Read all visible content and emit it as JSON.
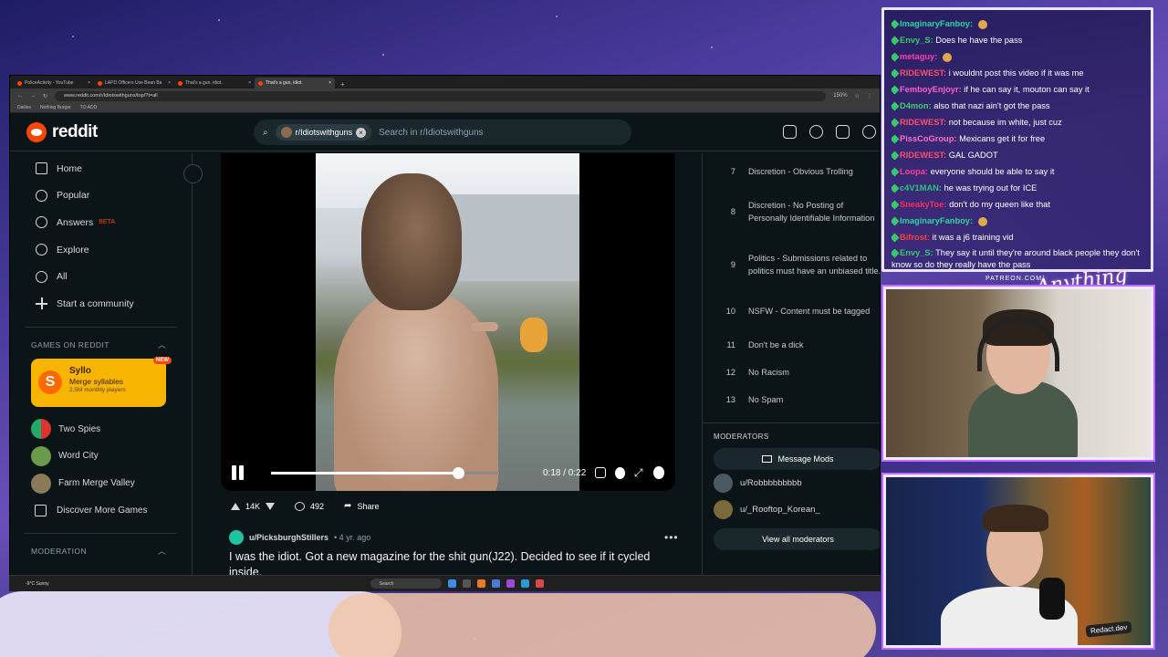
{
  "browser": {
    "tabs": [
      {
        "label": "PoliceActivity - YouTube",
        "active": false
      },
      {
        "label": "LAPD Officers Use Bean Ba",
        "active": false
      },
      {
        "label": "That's a gun, idiot.",
        "active": false
      },
      {
        "label": "That's a gun, idiot.",
        "active": true
      }
    ],
    "url": "www.reddit.com/r/Idiotswithguns/top/?t=all",
    "zoom": "150%",
    "bookmarks": [
      "Dailies",
      "Nothing Burger",
      "TO ADD"
    ]
  },
  "reddit": {
    "logo_text": "reddit",
    "search": {
      "chip": "r/Idiotswithguns",
      "placeholder": "Search in r/Idiotswithguns"
    },
    "nav": [
      {
        "label": "Home",
        "icon": "home-icon"
      },
      {
        "label": "Popular",
        "icon": "popular-icon"
      },
      {
        "label": "Answers",
        "icon": "answers-icon",
        "badge": "BETA"
      },
      {
        "label": "Explore",
        "icon": "explore-icon"
      },
      {
        "label": "All",
        "icon": "all-icon"
      },
      {
        "label": "Start a community",
        "icon": "plus-icon"
      }
    ],
    "games_heading": "GAMES ON REDDIT",
    "featured_game": {
      "title": "Syllo",
      "subtitle": "Merge syllables",
      "players": "2.5M monthly players",
      "badge": "NEW"
    },
    "games": [
      "Two Spies",
      "Word City",
      "Farm Merge Valley",
      "Discover More Games"
    ],
    "moderation_heading": "MODERATION",
    "video": {
      "time": "0:18 / 0:22",
      "progress": 0.82
    },
    "post": {
      "votes": "14K",
      "comments": "492",
      "share": "Share",
      "author": "u/PicksburghStillers",
      "age": "• 4 yr. ago",
      "title": "I was the idiot. Got a new magazine for the shit gun(J22). Decided to see if it cycled inside."
    },
    "rules": [
      {
        "n": "7",
        "text": "Discretion - Obvious Trolling"
      },
      {
        "n": "8",
        "text": "Discretion - No Posting of Personally Identifiable Information"
      },
      {
        "n": "9",
        "text": "Politics - Submissions related to politics must have an unbiased title."
      },
      {
        "n": "10",
        "text": "NSFW - Content must be tagged"
      },
      {
        "n": "11",
        "text": "Don't be a dick"
      },
      {
        "n": "12",
        "text": "No Racism"
      },
      {
        "n": "13",
        "text": "No Spam"
      }
    ],
    "moderators_heading": "MODERATORS",
    "message_mods": "Message Mods",
    "moderators": [
      "u/Robbbbbbbbb",
      "u/_Rooftop_Korean_"
    ],
    "view_all": "View all moderators"
  },
  "taskbar": {
    "weather": "-9°C Sunny",
    "search": "Search"
  },
  "chat": [
    {
      "name": "ImaginaryFanboy:",
      "color": "#2bd7a0",
      "text": ""
    },
    {
      "name": "Envy_S:",
      "color": "#37c96b",
      "text": "Does he have the pass"
    },
    {
      "name": "metaguy:",
      "color": "#ff3fb4",
      "text": ""
    },
    {
      "name": "RIDEWEST:",
      "color": "#ff4d6d",
      "text": "i wouldnt post this video if it was me"
    },
    {
      "name": "FemboyEnjoyr:",
      "color": "#ff5fd0",
      "text": "if he can say it, mouton can say it"
    },
    {
      "name": "D4mon:",
      "color": "#3fd06a",
      "text": "also that nazi ain't got the pass"
    },
    {
      "name": "RIDEWEST:",
      "color": "#ff4d6d",
      "text": "not because im white, just cuz"
    },
    {
      "name": "PissCoGroup:",
      "color": "#ff6ec7",
      "text": "Mexicans get it for free"
    },
    {
      "name": "RIDEWEST:",
      "color": "#ff4d6d",
      "text": "GAL GADOT"
    },
    {
      "name": "Loopa:",
      "color": "#ff3f9a",
      "text": "everyone should be able to say it"
    },
    {
      "name": "c4V1MAN:",
      "color": "#2ec27e",
      "text": "he was trying out for ICE"
    },
    {
      "name": "SneakyToe:",
      "color": "#ff2d55",
      "text": "don't do my queen like that"
    },
    {
      "name": "ImaginaryFanboy:",
      "color": "#2bd7a0",
      "text": ""
    },
    {
      "name": "Bifrost:",
      "color": "#ff3c3c",
      "text": "it was a j6 training vid"
    },
    {
      "name": "Envy_S:",
      "color": "#37c96b",
      "text": "They say it until they're around black people they don't know so do they really have the pass"
    }
  ],
  "overlay": {
    "patreon": "PATREON.COM/",
    "watermark": "Redact.dev"
  },
  "colors": {
    "accent": "#ff4500",
    "bg": "#0b1416",
    "syllo": "#f7b500"
  }
}
